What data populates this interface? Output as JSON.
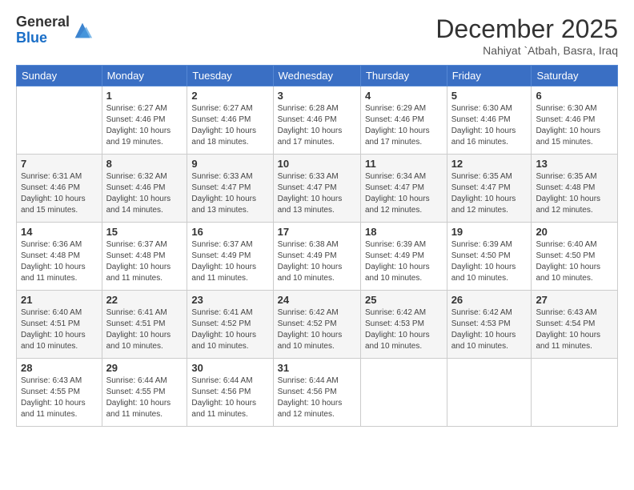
{
  "header": {
    "logo_general": "General",
    "logo_blue": "Blue",
    "month_title": "December 2025",
    "location": "Nahiyat `Atbah, Basra, Iraq"
  },
  "days_of_week": [
    "Sunday",
    "Monday",
    "Tuesday",
    "Wednesday",
    "Thursday",
    "Friday",
    "Saturday"
  ],
  "weeks": [
    [
      {
        "day": "",
        "info": ""
      },
      {
        "day": "1",
        "info": "Sunrise: 6:27 AM\nSunset: 4:46 PM\nDaylight: 10 hours\nand 19 minutes."
      },
      {
        "day": "2",
        "info": "Sunrise: 6:27 AM\nSunset: 4:46 PM\nDaylight: 10 hours\nand 18 minutes."
      },
      {
        "day": "3",
        "info": "Sunrise: 6:28 AM\nSunset: 4:46 PM\nDaylight: 10 hours\nand 17 minutes."
      },
      {
        "day": "4",
        "info": "Sunrise: 6:29 AM\nSunset: 4:46 PM\nDaylight: 10 hours\nand 17 minutes."
      },
      {
        "day": "5",
        "info": "Sunrise: 6:30 AM\nSunset: 4:46 PM\nDaylight: 10 hours\nand 16 minutes."
      },
      {
        "day": "6",
        "info": "Sunrise: 6:30 AM\nSunset: 4:46 PM\nDaylight: 10 hours\nand 15 minutes."
      }
    ],
    [
      {
        "day": "7",
        "info": "Sunrise: 6:31 AM\nSunset: 4:46 PM\nDaylight: 10 hours\nand 15 minutes."
      },
      {
        "day": "8",
        "info": "Sunrise: 6:32 AM\nSunset: 4:46 PM\nDaylight: 10 hours\nand 14 minutes."
      },
      {
        "day": "9",
        "info": "Sunrise: 6:33 AM\nSunset: 4:47 PM\nDaylight: 10 hours\nand 13 minutes."
      },
      {
        "day": "10",
        "info": "Sunrise: 6:33 AM\nSunset: 4:47 PM\nDaylight: 10 hours\nand 13 minutes."
      },
      {
        "day": "11",
        "info": "Sunrise: 6:34 AM\nSunset: 4:47 PM\nDaylight: 10 hours\nand 12 minutes."
      },
      {
        "day": "12",
        "info": "Sunrise: 6:35 AM\nSunset: 4:47 PM\nDaylight: 10 hours\nand 12 minutes."
      },
      {
        "day": "13",
        "info": "Sunrise: 6:35 AM\nSunset: 4:48 PM\nDaylight: 10 hours\nand 12 minutes."
      }
    ],
    [
      {
        "day": "14",
        "info": "Sunrise: 6:36 AM\nSunset: 4:48 PM\nDaylight: 10 hours\nand 11 minutes."
      },
      {
        "day": "15",
        "info": "Sunrise: 6:37 AM\nSunset: 4:48 PM\nDaylight: 10 hours\nand 11 minutes."
      },
      {
        "day": "16",
        "info": "Sunrise: 6:37 AM\nSunset: 4:49 PM\nDaylight: 10 hours\nand 11 minutes."
      },
      {
        "day": "17",
        "info": "Sunrise: 6:38 AM\nSunset: 4:49 PM\nDaylight: 10 hours\nand 10 minutes."
      },
      {
        "day": "18",
        "info": "Sunrise: 6:39 AM\nSunset: 4:49 PM\nDaylight: 10 hours\nand 10 minutes."
      },
      {
        "day": "19",
        "info": "Sunrise: 6:39 AM\nSunset: 4:50 PM\nDaylight: 10 hours\nand 10 minutes."
      },
      {
        "day": "20",
        "info": "Sunrise: 6:40 AM\nSunset: 4:50 PM\nDaylight: 10 hours\nand 10 minutes."
      }
    ],
    [
      {
        "day": "21",
        "info": "Sunrise: 6:40 AM\nSunset: 4:51 PM\nDaylight: 10 hours\nand 10 minutes."
      },
      {
        "day": "22",
        "info": "Sunrise: 6:41 AM\nSunset: 4:51 PM\nDaylight: 10 hours\nand 10 minutes."
      },
      {
        "day": "23",
        "info": "Sunrise: 6:41 AM\nSunset: 4:52 PM\nDaylight: 10 hours\nand 10 minutes."
      },
      {
        "day": "24",
        "info": "Sunrise: 6:42 AM\nSunset: 4:52 PM\nDaylight: 10 hours\nand 10 minutes."
      },
      {
        "day": "25",
        "info": "Sunrise: 6:42 AM\nSunset: 4:53 PM\nDaylight: 10 hours\nand 10 minutes."
      },
      {
        "day": "26",
        "info": "Sunrise: 6:42 AM\nSunset: 4:53 PM\nDaylight: 10 hours\nand 10 minutes."
      },
      {
        "day": "27",
        "info": "Sunrise: 6:43 AM\nSunset: 4:54 PM\nDaylight: 10 hours\nand 11 minutes."
      }
    ],
    [
      {
        "day": "28",
        "info": "Sunrise: 6:43 AM\nSunset: 4:55 PM\nDaylight: 10 hours\nand 11 minutes."
      },
      {
        "day": "29",
        "info": "Sunrise: 6:44 AM\nSunset: 4:55 PM\nDaylight: 10 hours\nand 11 minutes."
      },
      {
        "day": "30",
        "info": "Sunrise: 6:44 AM\nSunset: 4:56 PM\nDaylight: 10 hours\nand 11 minutes."
      },
      {
        "day": "31",
        "info": "Sunrise: 6:44 AM\nSunset: 4:56 PM\nDaylight: 10 hours\nand 12 minutes."
      },
      {
        "day": "",
        "info": ""
      },
      {
        "day": "",
        "info": ""
      },
      {
        "day": "",
        "info": ""
      }
    ]
  ]
}
